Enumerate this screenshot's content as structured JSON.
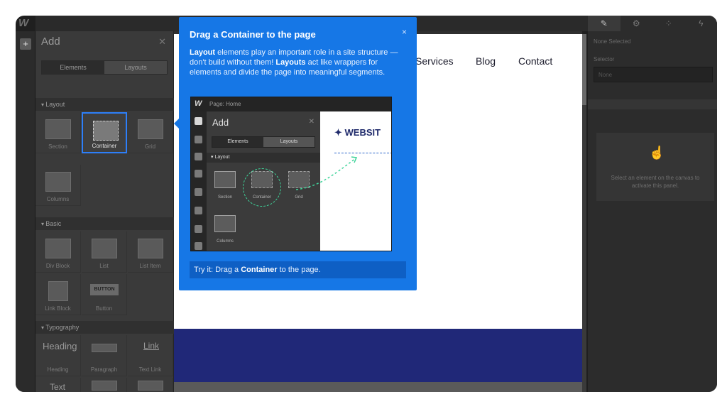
{
  "app": {
    "logo": "W"
  },
  "add_panel": {
    "title": "Add",
    "tabs": [
      "Elements",
      "Layouts"
    ],
    "sections": [
      "Layout",
      "Basic",
      "Typography"
    ],
    "layout_items": [
      "Section",
      "Container",
      "Grid",
      "Columns"
    ],
    "basic_items": [
      "Div Block",
      "List",
      "List Item",
      "Link Block",
      "Button"
    ],
    "button_chip": "BUTTON",
    "typography_items": [
      "Heading",
      "Paragraph",
      "Text Link",
      "Text"
    ],
    "typography_tile_texts": [
      "Heading",
      "Link",
      "Text"
    ]
  },
  "canvas": {
    "nav": [
      "Services",
      "Blog",
      "Contact"
    ],
    "hero_color": "#202878"
  },
  "right_panel": {
    "none_selected": "None Selected",
    "selector_label": "Selector",
    "selector_placeholder": "None",
    "empty_message": "Select an element on the canvas to activate this panel."
  },
  "popup": {
    "title": "Drag a Container to the page",
    "close": "×",
    "body_1": "Layout",
    "body_2": " elements play an important role in a site structure — don't build without them! ",
    "body_3": "Layouts",
    "body_4": " act like wrappers for elements and divide the page into meaningful segments.",
    "mini": {
      "logo": "W",
      "page_label": "Page: Home",
      "panel_title": "Add",
      "tabs": [
        "Elements",
        "Layouts"
      ],
      "section": "Layout",
      "items": [
        "Section",
        "Container",
        "Grid",
        "Columns"
      ],
      "website_text": "✦ WEBSIT"
    },
    "tryit_1": "Try it: Drag a ",
    "tryit_2": "Container",
    "tryit_3": " to the page.",
    "accent": "#1677e6"
  }
}
